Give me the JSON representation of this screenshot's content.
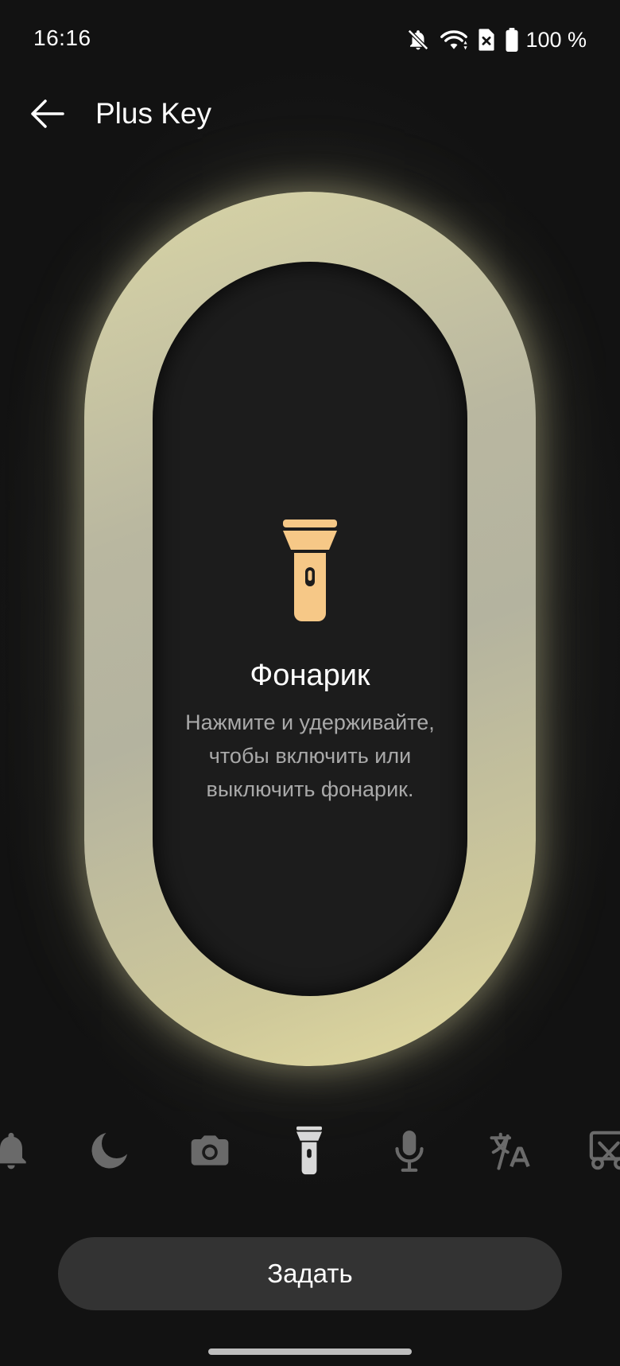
{
  "status_bar": {
    "time": "16:16",
    "battery": "100 %",
    "icons": [
      "notifications-off-icon",
      "wifi-icon",
      "no-sim-icon",
      "battery-icon"
    ]
  },
  "app_bar": {
    "title": "Plus Key",
    "back_icon": "arrow-left-icon"
  },
  "key": {
    "selected_icon": "flashlight-icon",
    "title": "Фонарик",
    "description": "Нажмите и удерживайте, чтобы включить или выключить фонарик.",
    "accent_color": "#f6c887",
    "glow_color": "#d9d5a6"
  },
  "options": [
    {
      "icon": "bell-icon",
      "selected": false
    },
    {
      "icon": "moon-icon",
      "selected": false
    },
    {
      "icon": "camera-icon",
      "selected": false
    },
    {
      "icon": "flashlight-icon",
      "selected": true
    },
    {
      "icon": "microphone-icon",
      "selected": false
    },
    {
      "icon": "translate-icon",
      "selected": false
    },
    {
      "icon": "screenshot-icon",
      "selected": false
    }
  ],
  "set_button": {
    "label": "Задать"
  }
}
